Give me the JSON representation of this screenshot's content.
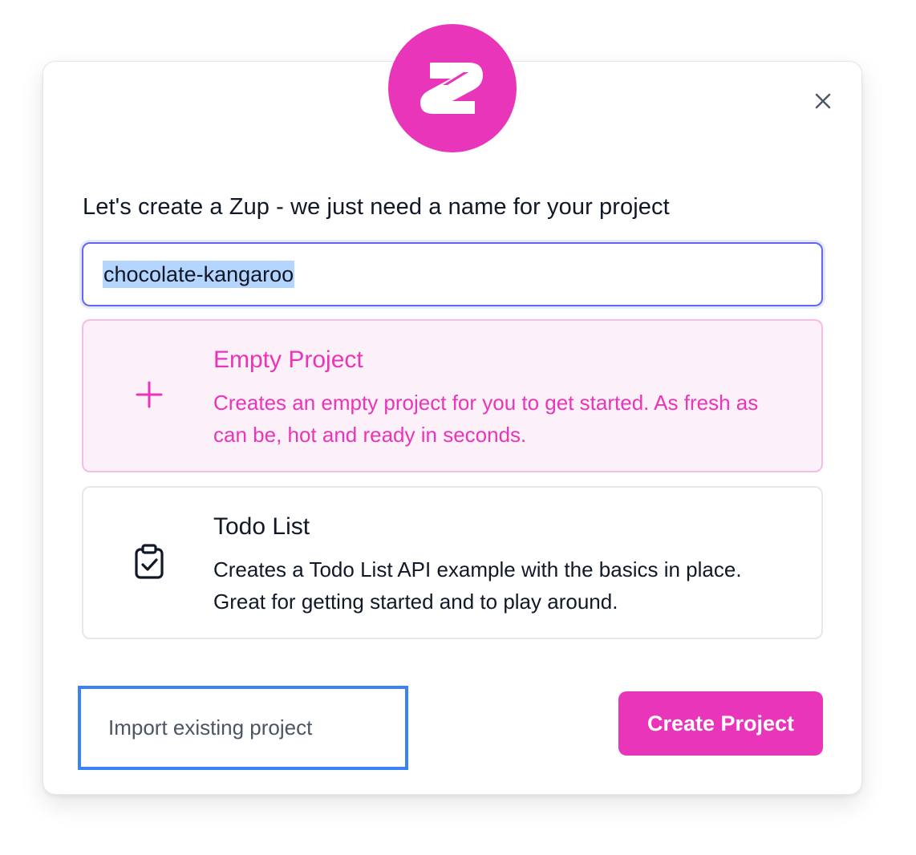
{
  "colors": {
    "brand": "#e935b9",
    "focus_ring": "#6366f1",
    "selected_bg": "#fcf0f9",
    "import_outline": "#3b82f6"
  },
  "dialog": {
    "logo_icon": "zuplo-logo-icon",
    "close_icon": "close-icon",
    "heading": "Let's create a Zup - we just need a name for your project",
    "project_name_value": "chocolate-kangaroo"
  },
  "options": [
    {
      "icon": "plus-icon",
      "title": "Empty Project",
      "description": "Creates an empty project for you to get started. As fresh as can be, hot and ready in seconds.",
      "selected": true
    },
    {
      "icon": "clipboard-check-icon",
      "title": "Todo List",
      "description": "Creates a Todo List API example with the basics in place. Great for getting started and to play around.",
      "selected": false
    }
  ],
  "footer": {
    "import_label": "Import existing project",
    "create_label": "Create Project"
  }
}
